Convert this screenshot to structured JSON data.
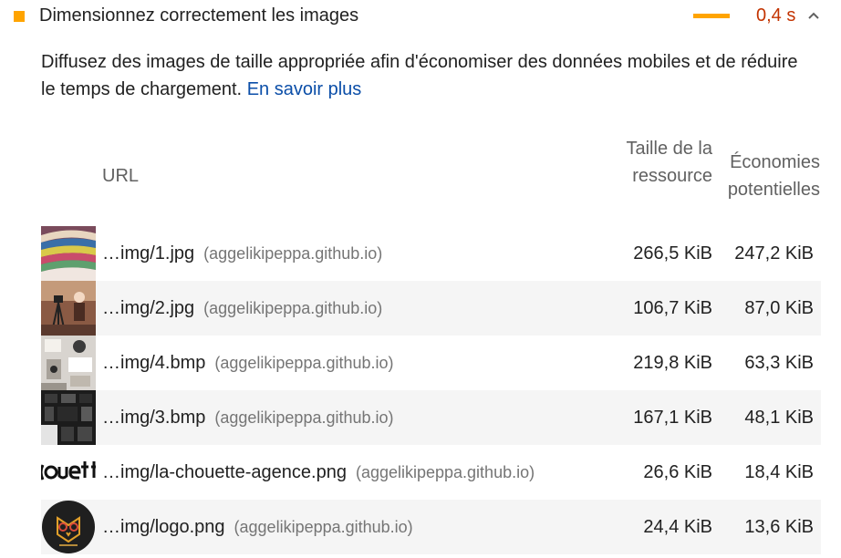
{
  "audit": {
    "title": "Dimensionnez correctement les images",
    "savings": "0,4 s",
    "status_color": "#ffa400",
    "savings_color": "#c33300",
    "description": "Diffusez des images de taille appropriée afin d'économiser des données mobiles et de réduire le temps de chargement.",
    "learn_more": "En savoir plus",
    "link_color": "#0b4ea8"
  },
  "table": {
    "headers": {
      "url": "URL",
      "size": "Taille de la ressource",
      "savings": "Économies potentielles"
    },
    "rows": [
      {
        "url": "…img/1.jpg",
        "host": "(aggelikipeppa.github.io)",
        "size": "266,5 KiB",
        "savings": "247,2 KiB",
        "thumb": "colorful-scarves-photo"
      },
      {
        "url": "…img/2.jpg",
        "host": "(aggelikipeppa.github.io)",
        "size": "106,7 KiB",
        "savings": "87,0 KiB",
        "thumb": "camera-tripod-photo"
      },
      {
        "url": "…img/4.bmp",
        "host": "(aggelikipeppa.github.io)",
        "size": "219,8 KiB",
        "savings": "63,3 KiB",
        "thumb": "desk-flatlay-photo"
      },
      {
        "url": "…img/3.bmp",
        "host": "(aggelikipeppa.github.io)",
        "size": "167,1 KiB",
        "savings": "48,1 KiB",
        "thumb": "dark-devices-photo"
      },
      {
        "url": "…img/la-chouette-agence.png",
        "host": "(aggelikipeppa.github.io)",
        "size": "26,6 KiB",
        "savings": "18,4 KiB",
        "thumb": "wordmark-logo"
      },
      {
        "url": "…img/logo.png",
        "host": "(aggelikipeppa.github.io)",
        "size": "24,4 KiB",
        "savings": "13,6 KiB",
        "thumb": "owl-logo"
      }
    ]
  },
  "icons": {
    "status": "square-icon",
    "toggle": "chevron-up-icon"
  }
}
